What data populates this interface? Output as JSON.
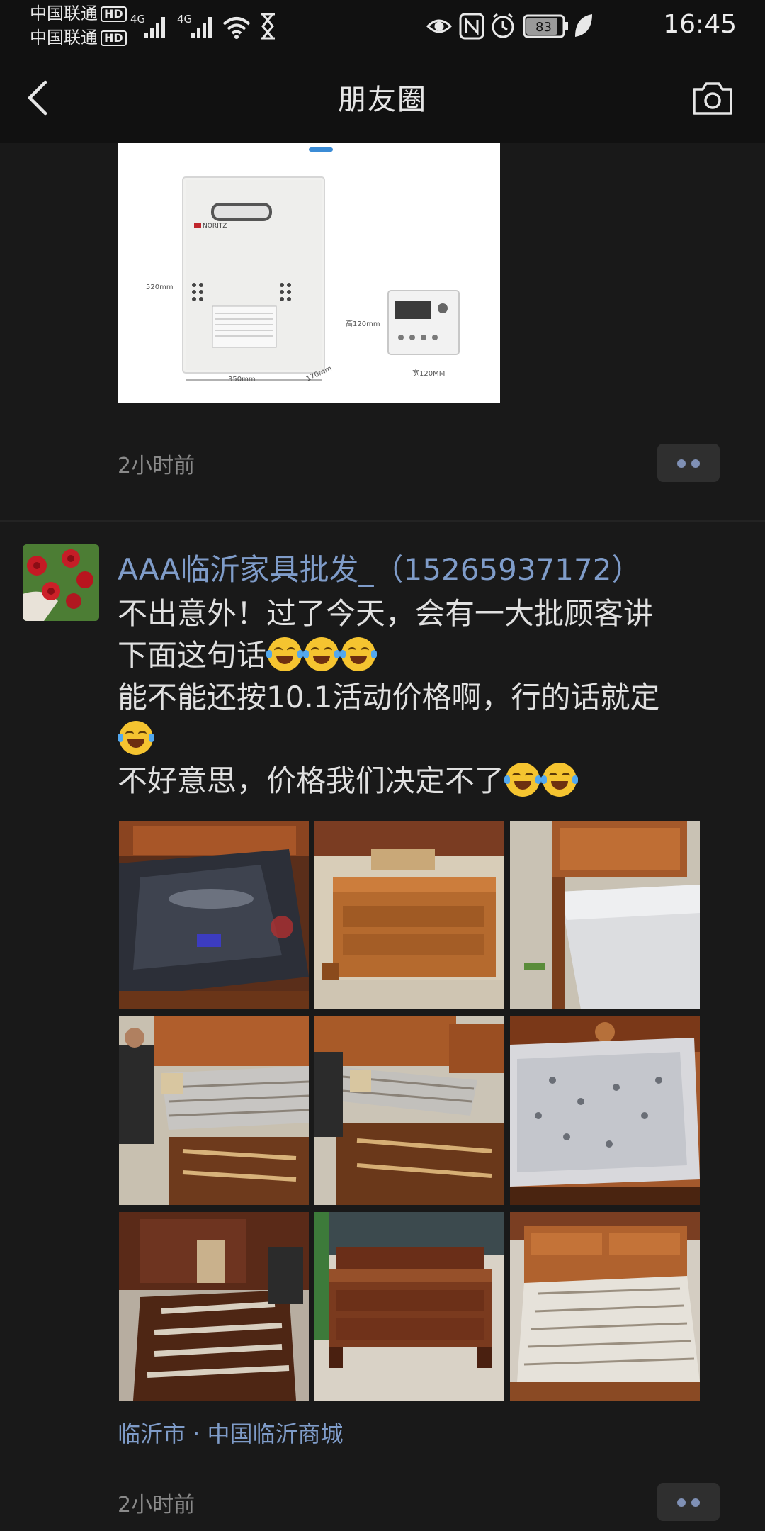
{
  "status_bar": {
    "carrier_1": "中国联通",
    "carrier_2": "中国联通",
    "hd_badge": "HD",
    "network_1": "4G",
    "network_2": "4G",
    "battery": "83",
    "time": "16:45"
  },
  "nav": {
    "title": "朋友圈"
  },
  "previous_post": {
    "image": {
      "brand": "NORITZ",
      "dim_height": "520mm",
      "dim_width": "350mm",
      "dim_depth": "170mm",
      "remote_height": "高120mm",
      "remote_width": "宽120MM"
    },
    "time": "2小时前"
  },
  "post": {
    "author": "AAA临沂家具批发_（15265937172）",
    "lines": [
      "不出意外！过了今天，会有一大批顾客讲",
      "下面这句话",
      "能不能还按10.1活动价格啊，行的话就定",
      "不好意思，价格我们决定不了"
    ],
    "photos": [
      "bed-mattress-plastic",
      "headboard-on-box",
      "bed-with-mattress",
      "worker-assembling-slats",
      "lifting-bed-frame",
      "bed-plastic-cover",
      "dark-bed-slats",
      "bed-footboard",
      "bed-slats-frame"
    ],
    "location": "临沂市 · 中国临沂商城",
    "time": "2小时前"
  },
  "colors": {
    "background": "#191919",
    "link": "#7f9cc9",
    "text": "#e0e0e0",
    "muted": "#8a8a8a"
  }
}
